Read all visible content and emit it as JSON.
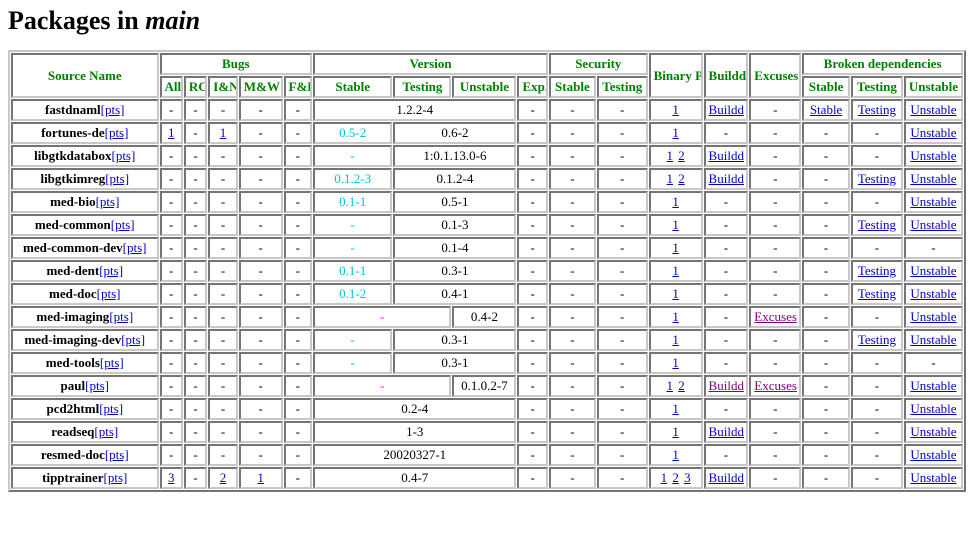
{
  "page": {
    "title_prefix": "Packages in ",
    "title_emphasis": "main"
  },
  "colors": {
    "header_green": "#008000",
    "link_blue": "#0000cc",
    "link_visited_purple": "#800080",
    "old_version_cyan": "#00c2d6",
    "merged_dash_magenta": "#ff00ff",
    "text_black": "#000000",
    "border_gray": "#c8c8c8",
    "background": "#ffffff"
  },
  "labels": {
    "pts": "[pts]",
    "dash": "-",
    "buildd": "Buildd",
    "excuses": "Excuses",
    "stable": "Stable",
    "testing": "Testing",
    "unstable": "Unstable"
  },
  "header": {
    "group_source_name": "Source Name",
    "group_bugs": "Bugs",
    "group_version": "Version",
    "group_security": "Security",
    "group_binary_package_page": "Binary Package Page",
    "group_buildd": "Buildd",
    "group_excuses": "Excuses",
    "group_broken_dependencies": "Broken dependencies",
    "bugs_cols": [
      "All",
      "RC",
      "I&N",
      "M&W",
      "F&P"
    ],
    "version_cols": [
      "Stable",
      "Testing",
      "Unstable",
      "Exp."
    ],
    "security_cols": [
      "Stable",
      "Testing"
    ],
    "broken_cols": [
      "Stable",
      "Testing",
      "Unstable"
    ]
  },
  "rows": [
    {
      "name": "fastdnaml",
      "bugs": [
        "-",
        "-",
        "-",
        "-",
        "-"
      ],
      "version": [
        {
          "text": "1.2.2-4",
          "span": 3,
          "style": "plain"
        }
      ],
      "exp": "-",
      "security": [
        "-",
        "-"
      ],
      "bpp": [
        "1"
      ],
      "buildd": "Buildd",
      "buildd_link": true,
      "buildd_visited": false,
      "excuses": "-",
      "excuses_link": false,
      "excuses_visited": false,
      "broken": [
        {
          "text": "Stable",
          "link": true
        },
        {
          "text": "Testing",
          "link": true
        },
        {
          "text": "Unstable",
          "link": true
        }
      ]
    },
    {
      "name": "fortunes-de",
      "bugs": [
        "1",
        "-",
        "1",
        "-",
        "-"
      ],
      "version": [
        {
          "text": "0.5-2",
          "span": 1,
          "style": "old"
        },
        {
          "text": "0.6-2",
          "span": 2,
          "style": "plain"
        }
      ],
      "exp": "-",
      "security": [
        "-",
        "-"
      ],
      "bpp": [
        "1"
      ],
      "buildd": "-",
      "buildd_link": false,
      "buildd_visited": false,
      "excuses": "-",
      "excuses_link": false,
      "excuses_visited": false,
      "broken": [
        {
          "text": "-",
          "link": false
        },
        {
          "text": "-",
          "link": false
        },
        {
          "text": "Unstable",
          "link": true
        }
      ]
    },
    {
      "name": "libgtkdatabox",
      "bugs": [
        "-",
        "-",
        "-",
        "-",
        "-"
      ],
      "version": [
        {
          "text": "-",
          "span": 1,
          "style": "old-dash"
        },
        {
          "text": "1:0.1.13.0-6",
          "span": 2,
          "style": "plain"
        }
      ],
      "exp": "-",
      "security": [
        "-",
        "-"
      ],
      "bpp": [
        "1",
        "2"
      ],
      "buildd": "Buildd",
      "buildd_link": true,
      "buildd_visited": false,
      "excuses": "-",
      "excuses_link": false,
      "excuses_visited": false,
      "broken": [
        {
          "text": "-",
          "link": false
        },
        {
          "text": "-",
          "link": false
        },
        {
          "text": "Unstable",
          "link": true
        }
      ]
    },
    {
      "name": "libgtkimreg",
      "bugs": [
        "-",
        "-",
        "-",
        "-",
        "-"
      ],
      "version": [
        {
          "text": "0.1.2-3",
          "span": 1,
          "style": "old"
        },
        {
          "text": "0.1.2-4",
          "span": 2,
          "style": "plain"
        }
      ],
      "exp": "-",
      "security": [
        "-",
        "-"
      ],
      "bpp": [
        "1",
        "2"
      ],
      "buildd": "Buildd",
      "buildd_link": true,
      "buildd_visited": false,
      "excuses": "-",
      "excuses_link": false,
      "excuses_visited": false,
      "broken": [
        {
          "text": "-",
          "link": false
        },
        {
          "text": "Testing",
          "link": true
        },
        {
          "text": "Unstable",
          "link": true
        }
      ]
    },
    {
      "name": "med-bio",
      "bugs": [
        "-",
        "-",
        "-",
        "-",
        "-"
      ],
      "version": [
        {
          "text": "0.1-1",
          "span": 1,
          "style": "old"
        },
        {
          "text": "0.5-1",
          "span": 2,
          "style": "plain"
        }
      ],
      "exp": "-",
      "security": [
        "-",
        "-"
      ],
      "bpp": [
        "1"
      ],
      "buildd": "-",
      "buildd_link": false,
      "buildd_visited": false,
      "excuses": "-",
      "excuses_link": false,
      "excuses_visited": false,
      "broken": [
        {
          "text": "-",
          "link": false
        },
        {
          "text": "-",
          "link": false
        },
        {
          "text": "Unstable",
          "link": true
        }
      ]
    },
    {
      "name": "med-common",
      "bugs": [
        "-",
        "-",
        "-",
        "-",
        "-"
      ],
      "version": [
        {
          "text": "-",
          "span": 1,
          "style": "old-dash"
        },
        {
          "text": "0.1-3",
          "span": 2,
          "style": "plain"
        }
      ],
      "exp": "-",
      "security": [
        "-",
        "-"
      ],
      "bpp": [
        "1"
      ],
      "buildd": "-",
      "buildd_link": false,
      "buildd_visited": false,
      "excuses": "-",
      "excuses_link": false,
      "excuses_visited": false,
      "broken": [
        {
          "text": "-",
          "link": false
        },
        {
          "text": "Testing",
          "link": true
        },
        {
          "text": "Unstable",
          "link": true
        }
      ]
    },
    {
      "name": "med-common-dev",
      "bugs": [
        "-",
        "-",
        "-",
        "-",
        "-"
      ],
      "version": [
        {
          "text": "-",
          "span": 1,
          "style": "old-dash"
        },
        {
          "text": "0.1-4",
          "span": 2,
          "style": "plain"
        }
      ],
      "exp": "-",
      "security": [
        "-",
        "-"
      ],
      "bpp": [
        "1"
      ],
      "buildd": "-",
      "buildd_link": false,
      "buildd_visited": false,
      "excuses": "-",
      "excuses_link": false,
      "excuses_visited": false,
      "broken": [
        {
          "text": "-",
          "link": false
        },
        {
          "text": "-",
          "link": false
        },
        {
          "text": "-",
          "link": false
        }
      ]
    },
    {
      "name": "med-dent",
      "bugs": [
        "-",
        "-",
        "-",
        "-",
        "-"
      ],
      "version": [
        {
          "text": "0.1-1",
          "span": 1,
          "style": "old"
        },
        {
          "text": "0.3-1",
          "span": 2,
          "style": "plain"
        }
      ],
      "exp": "-",
      "security": [
        "-",
        "-"
      ],
      "bpp": [
        "1"
      ],
      "buildd": "-",
      "buildd_link": false,
      "buildd_visited": false,
      "excuses": "-",
      "excuses_link": false,
      "excuses_visited": false,
      "broken": [
        {
          "text": "-",
          "link": false
        },
        {
          "text": "Testing",
          "link": true
        },
        {
          "text": "Unstable",
          "link": true
        }
      ]
    },
    {
      "name": "med-doc",
      "bugs": [
        "-",
        "-",
        "-",
        "-",
        "-"
      ],
      "version": [
        {
          "text": "0.1-2",
          "span": 1,
          "style": "old"
        },
        {
          "text": "0.4-1",
          "span": 2,
          "style": "plain"
        }
      ],
      "exp": "-",
      "security": [
        "-",
        "-"
      ],
      "bpp": [
        "1"
      ],
      "buildd": "-",
      "buildd_link": false,
      "buildd_visited": false,
      "excuses": "-",
      "excuses_link": false,
      "excuses_visited": false,
      "broken": [
        {
          "text": "-",
          "link": false
        },
        {
          "text": "Testing",
          "link": true
        },
        {
          "text": "Unstable",
          "link": true
        }
      ]
    },
    {
      "name": "med-imaging",
      "bugs": [
        "-",
        "-",
        "-",
        "-",
        "-"
      ],
      "version": [
        {
          "text": "-",
          "span": 2,
          "style": "merged-dash"
        },
        {
          "text": "0.4-2",
          "span": 1,
          "style": "plain"
        }
      ],
      "exp": "-",
      "security": [
        "-",
        "-"
      ],
      "bpp": [
        "1"
      ],
      "buildd": "-",
      "buildd_link": false,
      "buildd_visited": false,
      "excuses": "Excuses",
      "excuses_link": true,
      "excuses_visited": true,
      "broken": [
        {
          "text": "-",
          "link": false
        },
        {
          "text": "-",
          "link": false
        },
        {
          "text": "Unstable",
          "link": true
        }
      ]
    },
    {
      "name": "med-imaging-dev",
      "bugs": [
        "-",
        "-",
        "-",
        "-",
        "-"
      ],
      "version": [
        {
          "text": "-",
          "span": 1,
          "style": "old-dash"
        },
        {
          "text": "0.3-1",
          "span": 2,
          "style": "plain"
        }
      ],
      "exp": "-",
      "security": [
        "-",
        "-"
      ],
      "bpp": [
        "1"
      ],
      "buildd": "-",
      "buildd_link": false,
      "buildd_visited": false,
      "excuses": "-",
      "excuses_link": false,
      "excuses_visited": false,
      "broken": [
        {
          "text": "-",
          "link": false
        },
        {
          "text": "Testing",
          "link": true
        },
        {
          "text": "Unstable",
          "link": true
        }
      ]
    },
    {
      "name": "med-tools",
      "bugs": [
        "-",
        "-",
        "-",
        "-",
        "-"
      ],
      "version": [
        {
          "text": "-",
          "span": 1,
          "style": "old-dash"
        },
        {
          "text": "0.3-1",
          "span": 2,
          "style": "plain"
        }
      ],
      "exp": "-",
      "security": [
        "-",
        "-"
      ],
      "bpp": [
        "1"
      ],
      "buildd": "-",
      "buildd_link": false,
      "buildd_visited": false,
      "excuses": "-",
      "excuses_link": false,
      "excuses_visited": false,
      "broken": [
        {
          "text": "-",
          "link": false
        },
        {
          "text": "-",
          "link": false
        },
        {
          "text": "-",
          "link": false
        }
      ]
    },
    {
      "name": "paul",
      "bugs": [
        "-",
        "-",
        "-",
        "-",
        "-"
      ],
      "version": [
        {
          "text": "-",
          "span": 2,
          "style": "merged-dash"
        },
        {
          "text": "0.1.0.2-7",
          "span": 1,
          "style": "plain"
        }
      ],
      "exp": "-",
      "security": [
        "-",
        "-"
      ],
      "bpp": [
        "1",
        "2"
      ],
      "buildd": "Buildd",
      "buildd_link": true,
      "buildd_visited": true,
      "excuses": "Excuses",
      "excuses_link": true,
      "excuses_visited": true,
      "broken": [
        {
          "text": "-",
          "link": false
        },
        {
          "text": "-",
          "link": false
        },
        {
          "text": "Unstable",
          "link": true
        }
      ]
    },
    {
      "name": "pcd2html",
      "bugs": [
        "-",
        "-",
        "-",
        "-",
        "-"
      ],
      "version": [
        {
          "text": "0.2-4",
          "span": 3,
          "style": "plain"
        }
      ],
      "exp": "-",
      "security": [
        "-",
        "-"
      ],
      "bpp": [
        "1"
      ],
      "buildd": "-",
      "buildd_link": false,
      "buildd_visited": false,
      "excuses": "-",
      "excuses_link": false,
      "excuses_visited": false,
      "broken": [
        {
          "text": "-",
          "link": false
        },
        {
          "text": "-",
          "link": false
        },
        {
          "text": "Unstable",
          "link": true
        }
      ]
    },
    {
      "name": "readseq",
      "bugs": [
        "-",
        "-",
        "-",
        "-",
        "-"
      ],
      "version": [
        {
          "text": "1-3",
          "span": 3,
          "style": "plain"
        }
      ],
      "exp": "-",
      "security": [
        "-",
        "-"
      ],
      "bpp": [
        "1"
      ],
      "buildd": "Buildd",
      "buildd_link": true,
      "buildd_visited": false,
      "excuses": "-",
      "excuses_link": false,
      "excuses_visited": false,
      "broken": [
        {
          "text": "-",
          "link": false
        },
        {
          "text": "-",
          "link": false
        },
        {
          "text": "Unstable",
          "link": true
        }
      ]
    },
    {
      "name": "resmed-doc",
      "bugs": [
        "-",
        "-",
        "-",
        "-",
        "-"
      ],
      "version": [
        {
          "text": "20020327-1",
          "span": 3,
          "style": "plain"
        }
      ],
      "exp": "-",
      "security": [
        "-",
        "-"
      ],
      "bpp": [
        "1"
      ],
      "buildd": "-",
      "buildd_link": false,
      "buildd_visited": false,
      "excuses": "-",
      "excuses_link": false,
      "excuses_visited": false,
      "broken": [
        {
          "text": "-",
          "link": false
        },
        {
          "text": "-",
          "link": false
        },
        {
          "text": "Unstable",
          "link": true
        }
      ]
    },
    {
      "name": "tipptrainer",
      "bugs": [
        "3",
        "-",
        "2",
        "1",
        "-"
      ],
      "version": [
        {
          "text": "0.4-7",
          "span": 3,
          "style": "plain"
        }
      ],
      "exp": "-",
      "security": [
        "-",
        "-"
      ],
      "bpp": [
        "1",
        "2",
        "3"
      ],
      "buildd": "Buildd",
      "buildd_link": true,
      "buildd_visited": false,
      "excuses": "-",
      "excuses_link": false,
      "excuses_visited": false,
      "broken": [
        {
          "text": "-",
          "link": false
        },
        {
          "text": "-",
          "link": false
        },
        {
          "text": "Unstable",
          "link": true
        }
      ]
    }
  ]
}
